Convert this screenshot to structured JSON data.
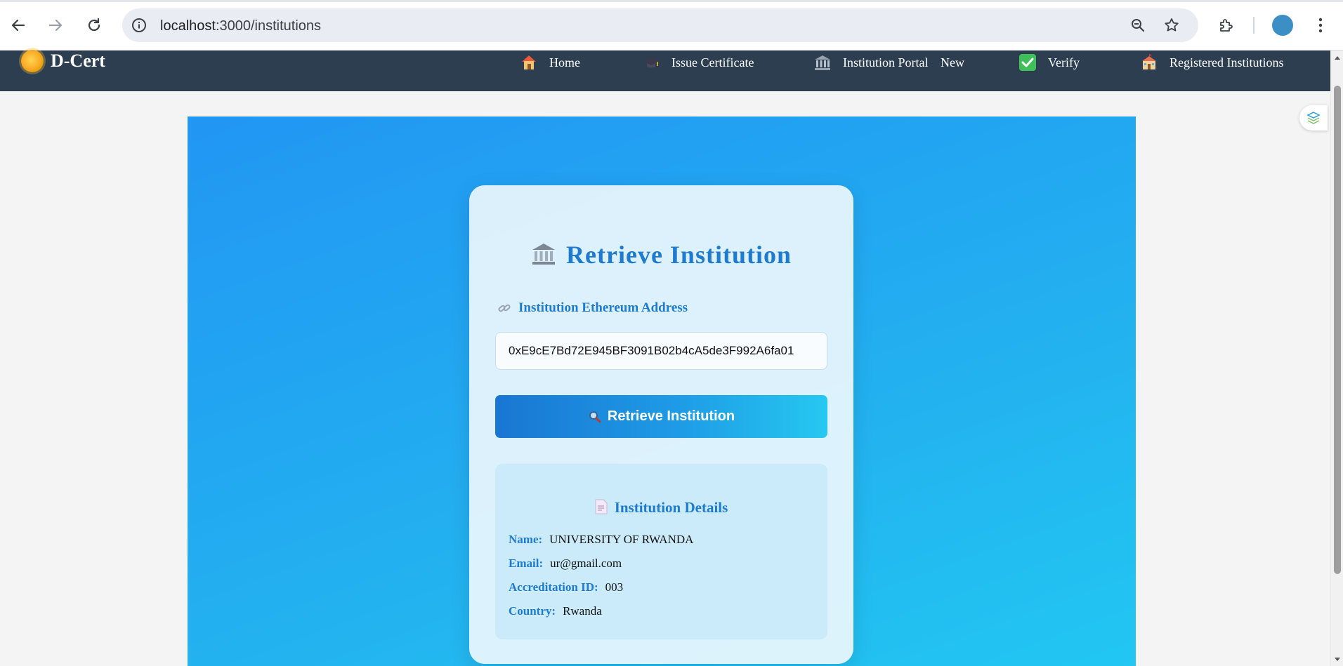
{
  "browser": {
    "url_host": "localhost",
    "url_path": ":3000/institutions"
  },
  "navbar": {
    "brand": "D-Cert",
    "items": [
      {
        "label": "Home",
        "icon": "house-icon"
      },
      {
        "label": "Issue Certificate",
        "icon": "graduation-cap-icon"
      },
      {
        "label": "Institution Portal",
        "icon": "classical-building-icon"
      },
      {
        "label": "New",
        "icon": ""
      },
      {
        "label": "Verify",
        "icon": "check-mark-icon"
      },
      {
        "label": "Registered Institutions",
        "icon": "school-icon"
      }
    ]
  },
  "card": {
    "title": "Retrieve Institution",
    "address_label": "Institution Ethereum Address",
    "address_value": "0xE9cE7Bd72E945BF3091B02b4cA5de3F992A6fa01",
    "button_label": "Retrieve Institution",
    "details": {
      "title": "Institution Details",
      "fields": [
        {
          "key": "Name:",
          "value": "UNIVERSITY OF RWANDA"
        },
        {
          "key": "Email:",
          "value": "ur@gmail.com"
        },
        {
          "key": "Accreditation ID:",
          "value": "003"
        },
        {
          "key": "Country:",
          "value": "Rwanda"
        }
      ]
    }
  },
  "colors": {
    "navbar_bg": "#2c3e50",
    "accent": "#1e7bd0",
    "hero_start": "#2196f3",
    "hero_end": "#22c7f2"
  }
}
